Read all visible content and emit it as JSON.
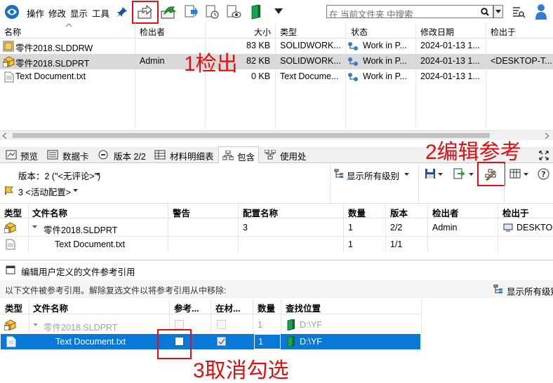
{
  "toolbar": {
    "menus": [
      "操作",
      "修改",
      "显示",
      "工具"
    ],
    "search_placeholder": "在 当前文件夹 中搜索"
  },
  "file_list": {
    "headers": [
      "名称",
      "检出者",
      "大小",
      "类型",
      "状态",
      "修改日期",
      "检出于"
    ],
    "rows": [
      {
        "name": "零件2018.SLDDRW",
        "checked_by": "",
        "size": "83 KB",
        "type": "SOLIDWORK...",
        "status": "Work in P...",
        "date": "2024-01-13 1...",
        "location": ""
      },
      {
        "name": "零件2018.SLDPRT",
        "checked_by": "Admin",
        "size": "82 KB",
        "type": "SOLIDWORK...",
        "status": "Work in P...",
        "date": "2024-01-13 1...",
        "location": "<DESKTOP-T..."
      },
      {
        "name": "Text Document.txt",
        "checked_by": "",
        "size": "0 KB",
        "type": "Text Docume...",
        "status": "Work in P...",
        "date": "2024-01-13 1...",
        "location": ""
      }
    ]
  },
  "annotations": {
    "step1": "1检出",
    "step2": "2编辑参考",
    "step3": "3取消勾选"
  },
  "tabs": [
    "预览",
    "数据卡",
    "版本 2/2",
    "材料明细表",
    "包含",
    "使用处"
  ],
  "contains": {
    "version_label": "版本：2 (\"<无评论>\")",
    "config_label": "3 <活动配置>",
    "show_all_levels": "显示所有级别",
    "headers": [
      "类型",
      "文件名称",
      "警告",
      "配置名称",
      "数量",
      "版本",
      "检出者",
      "检出于"
    ],
    "rows": [
      {
        "name": "零件2018.SLDPRT",
        "config": "3",
        "qty": "1",
        "version": "2/2",
        "checked_by": "Admin",
        "location": "DESKTOP-"
      },
      {
        "name": "Text Document.txt",
        "config": "",
        "qty": "1",
        "version": "1/1",
        "checked_by": "",
        "location": ""
      }
    ]
  },
  "dialog": {
    "title": "编辑用户定义的文件参考引用",
    "description": "以下文件被参考引用。解除复选文件以将参考引用从中移除:",
    "show_all_levels": "显示所有级别",
    "headers": [
      "类型",
      "文件名称",
      "参考...",
      "在材...",
      "数量",
      "查找位置"
    ],
    "rows": [
      {
        "name": "零件2018.SLDPRT",
        "qty": "1",
        "path": "D:\\YF"
      },
      {
        "name": "Text Document.txt",
        "qty": "1",
        "path": "D:\\YF"
      }
    ]
  }
}
